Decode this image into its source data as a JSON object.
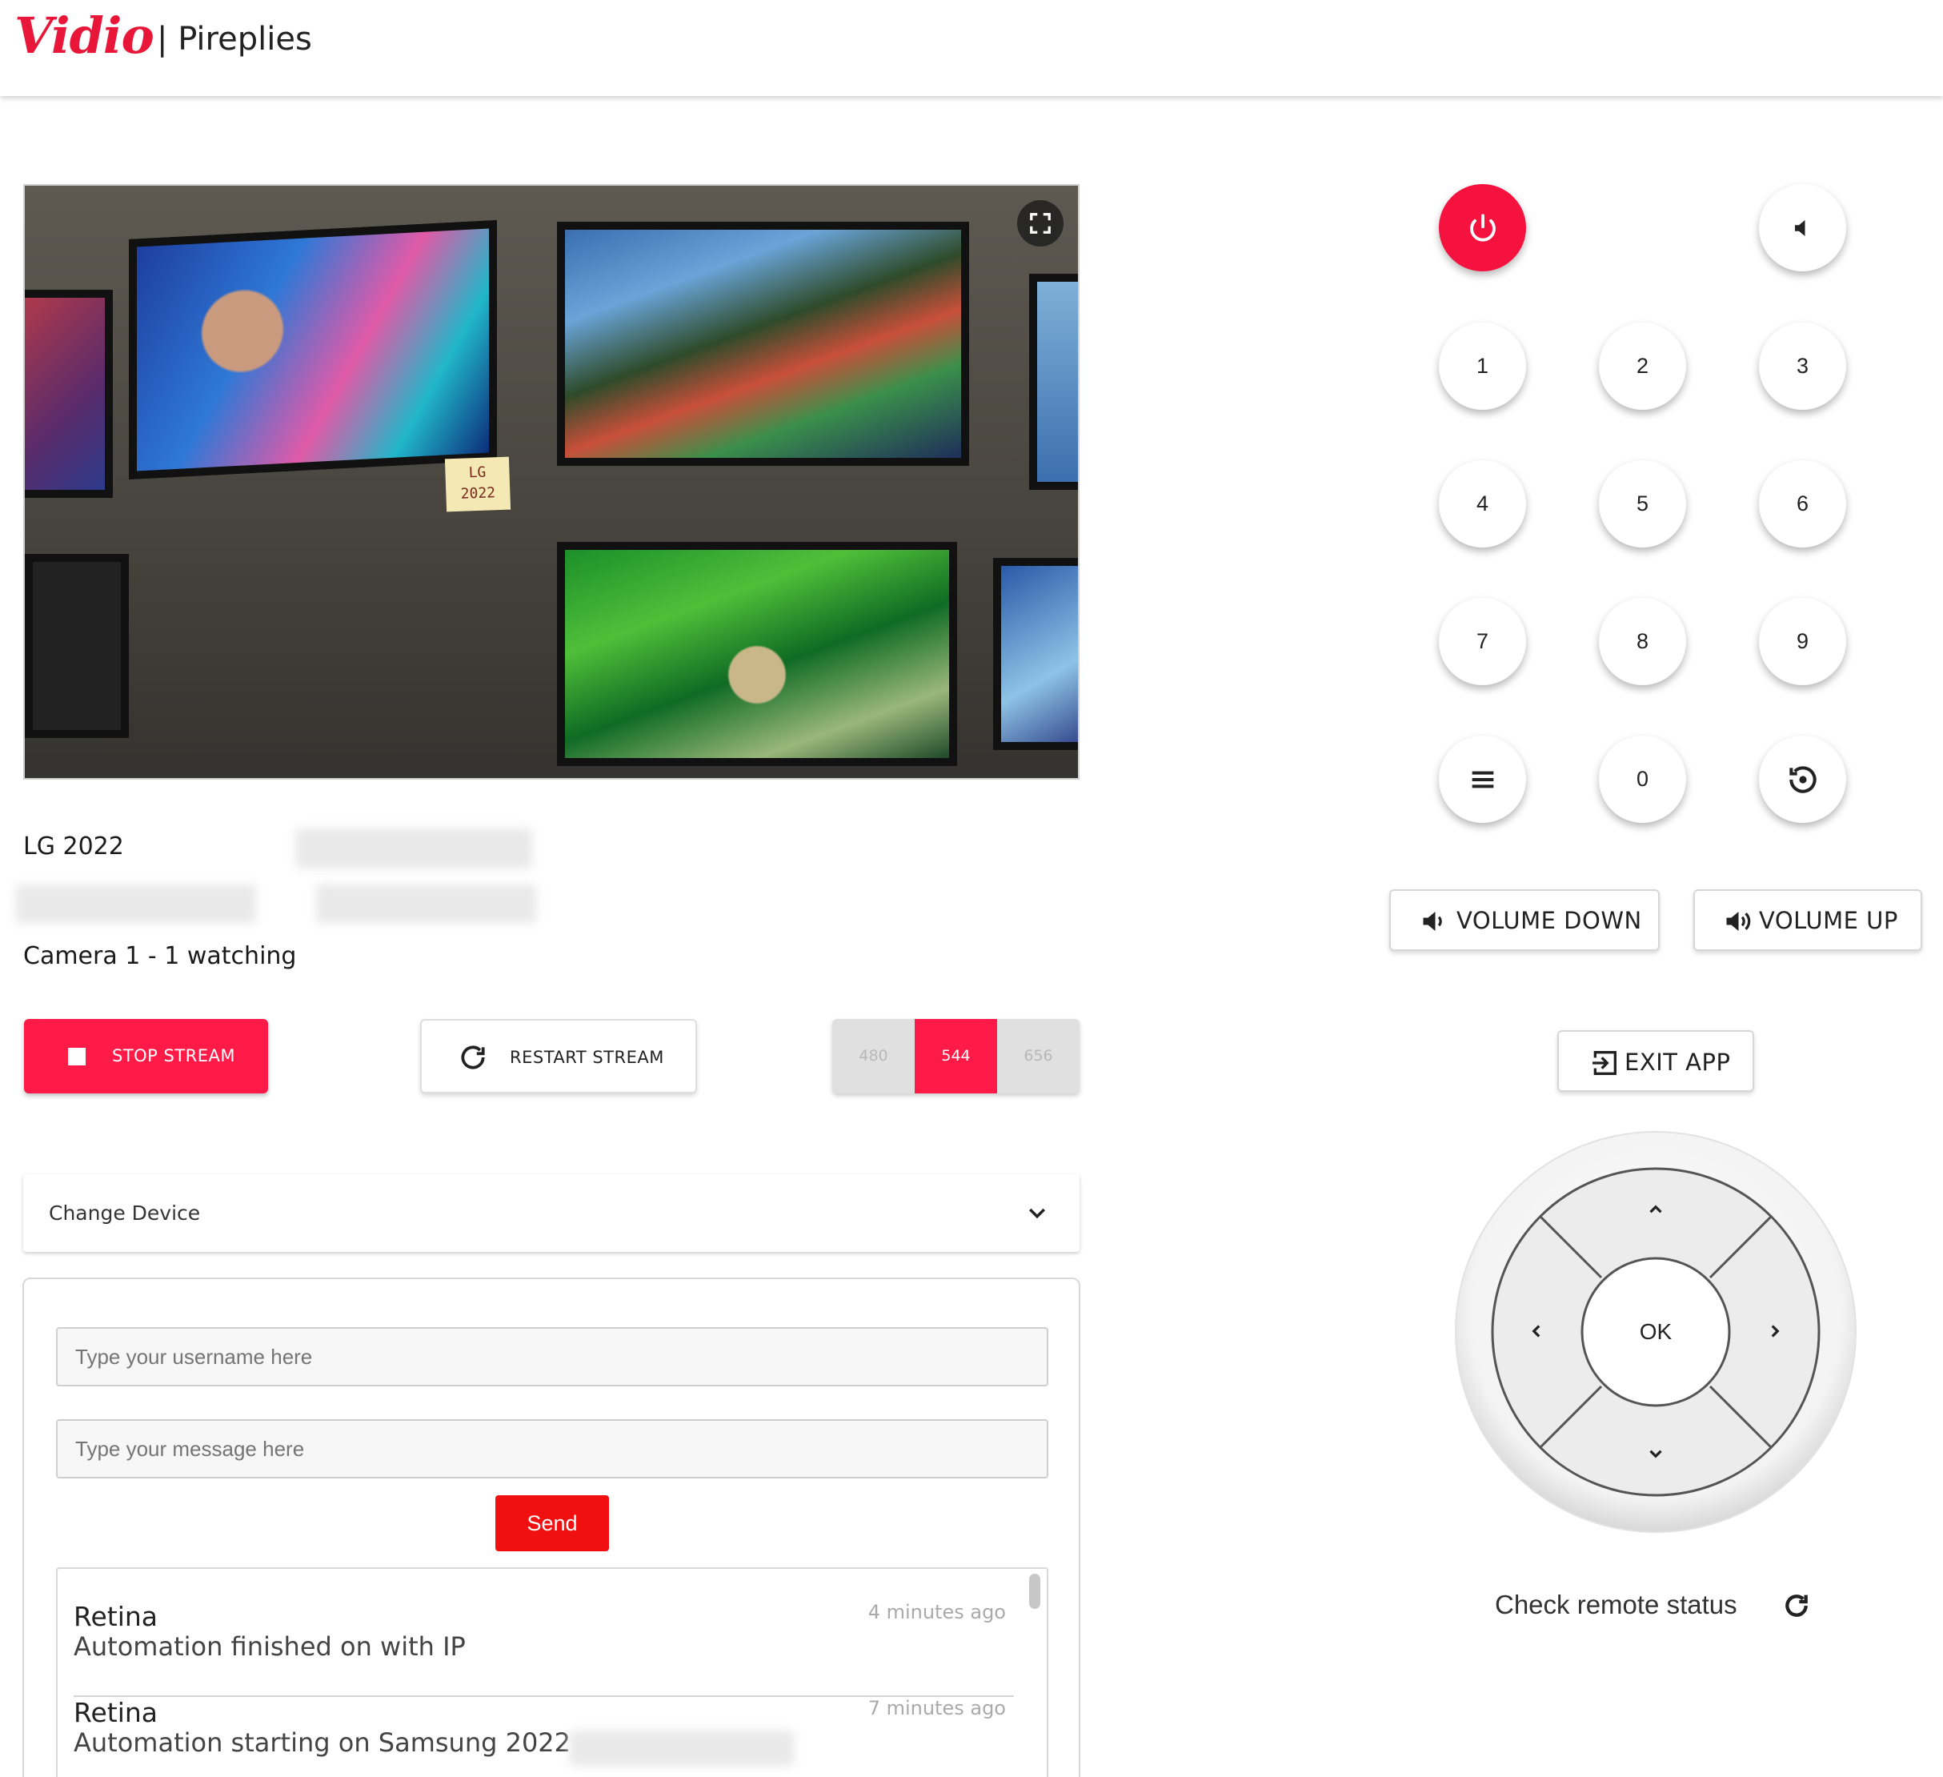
{
  "header": {
    "logo_text": "Vidio",
    "title": "| Pireplies"
  },
  "stream": {
    "device_name": "LG 2022",
    "camera_status": "Camera 1 - 1 watching",
    "note_line1": "LG",
    "note_line2": "2022"
  },
  "controls": {
    "stop_label": "STOP STREAM",
    "restart_label": "RESTART STREAM",
    "resolutions": [
      "480",
      "544",
      "656"
    ],
    "active_resolution": "544"
  },
  "device_select": {
    "label": "Change Device"
  },
  "chat": {
    "username_placeholder": "Type your username here",
    "message_placeholder": "Type your message here",
    "send_label": "Send",
    "messages": [
      {
        "user": "Retina",
        "text": "Automation finished on with IP",
        "time": "4 minutes ago"
      },
      {
        "user": "Retina",
        "text": "Automation starting on Samsung 2022",
        "time": "7 minutes ago"
      }
    ]
  },
  "remote": {
    "numpad": [
      "1",
      "2",
      "3",
      "4",
      "5",
      "6",
      "7",
      "8",
      "9",
      "0"
    ],
    "volume_down_label": "VOLUME DOWN",
    "volume_up_label": "VOLUME UP",
    "exit_label": "EXIT APP",
    "ok_label": "OK",
    "check_status_label": "Check remote status"
  },
  "colors": {
    "brand": "#e8173a",
    "power": "#f5123f",
    "stop": "#ff1a47",
    "send": "#f01010"
  },
  "icons": [
    "power-icon",
    "mute-icon",
    "menu-icon",
    "history-icon",
    "volume-down-icon",
    "volume-up-icon",
    "exit-icon",
    "refresh-icon",
    "fullscreen-icon",
    "chevron-down-icon",
    "stop-icon"
  ]
}
